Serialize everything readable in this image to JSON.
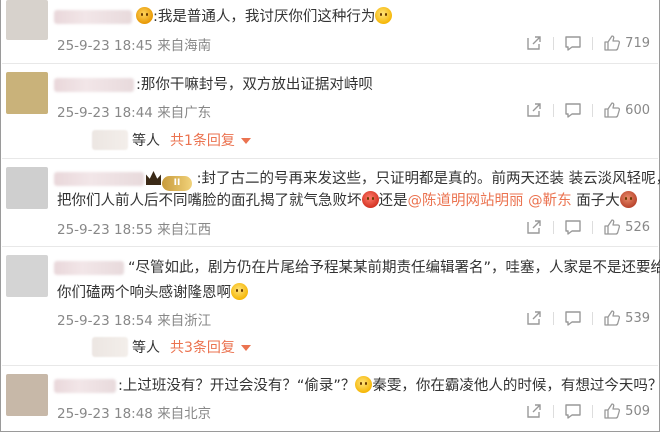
{
  "comments": [
    {
      "text": ":我是普通人，我讨厌你们这种行为",
      "date": "25-9-23 18:45",
      "source": "来自海南",
      "likes": "719",
      "avatar_color": "#d7d2cc"
    },
    {
      "text": ":那你干嘛封号，双方放出证据对峙呗",
      "date": "25-9-23 18:44",
      "source": "来自广东",
      "likes": "600",
      "avatar_color": "#c9b27a",
      "reply": {
        "who": "等人",
        "count": "共1条回复"
      }
    },
    {
      "text_line1": ":封了古二的号再来发这些，只证明都是真的。前两天还装 装云淡风轻呢，",
      "text_line2_a": "把你们人前人后不同嘴脸的面孔揭了就气急败坏",
      "mention1": "@陈道明网站明丽",
      "mention2": "@靳东",
      "text_line2_b": "还是",
      "text_line2_c": " 面子大",
      "badge": "II",
      "date": "25-9-23 18:55",
      "source": "来自江西",
      "likes": "526",
      "avatar_color": "#cfcfcf"
    },
    {
      "text_line1": "“尽管如此，剧方仍在片尾给予程某某前期责任编辑署名”，哇塞，人家是不是还要给",
      "text_line2": "你们磕两个响头感谢隆恩啊",
      "date": "25-9-23 18:54",
      "source": "来自浙江",
      "likes": "539",
      "avatar_color": "#d4d4d4",
      "reply": {
        "who": "等人",
        "count": "共3条回复"
      }
    },
    {
      "text_a": ":上过班没有？开过会没有？“偷录”？",
      "text_b": "秦雯，你在霸凌他人的时候，有想过今天吗？",
      "date": "25-9-23 18:48",
      "source": "来自北京",
      "likes": "509",
      "avatar_color": "#c7b8a8"
    }
  ],
  "icons": {
    "share": "share-icon",
    "comment": "comment-icon",
    "like": "thumbs-up-icon",
    "emoji": "smiley-emoji-icon"
  },
  "colors": {
    "accent": "#eb7350",
    "meta": "#888888"
  }
}
